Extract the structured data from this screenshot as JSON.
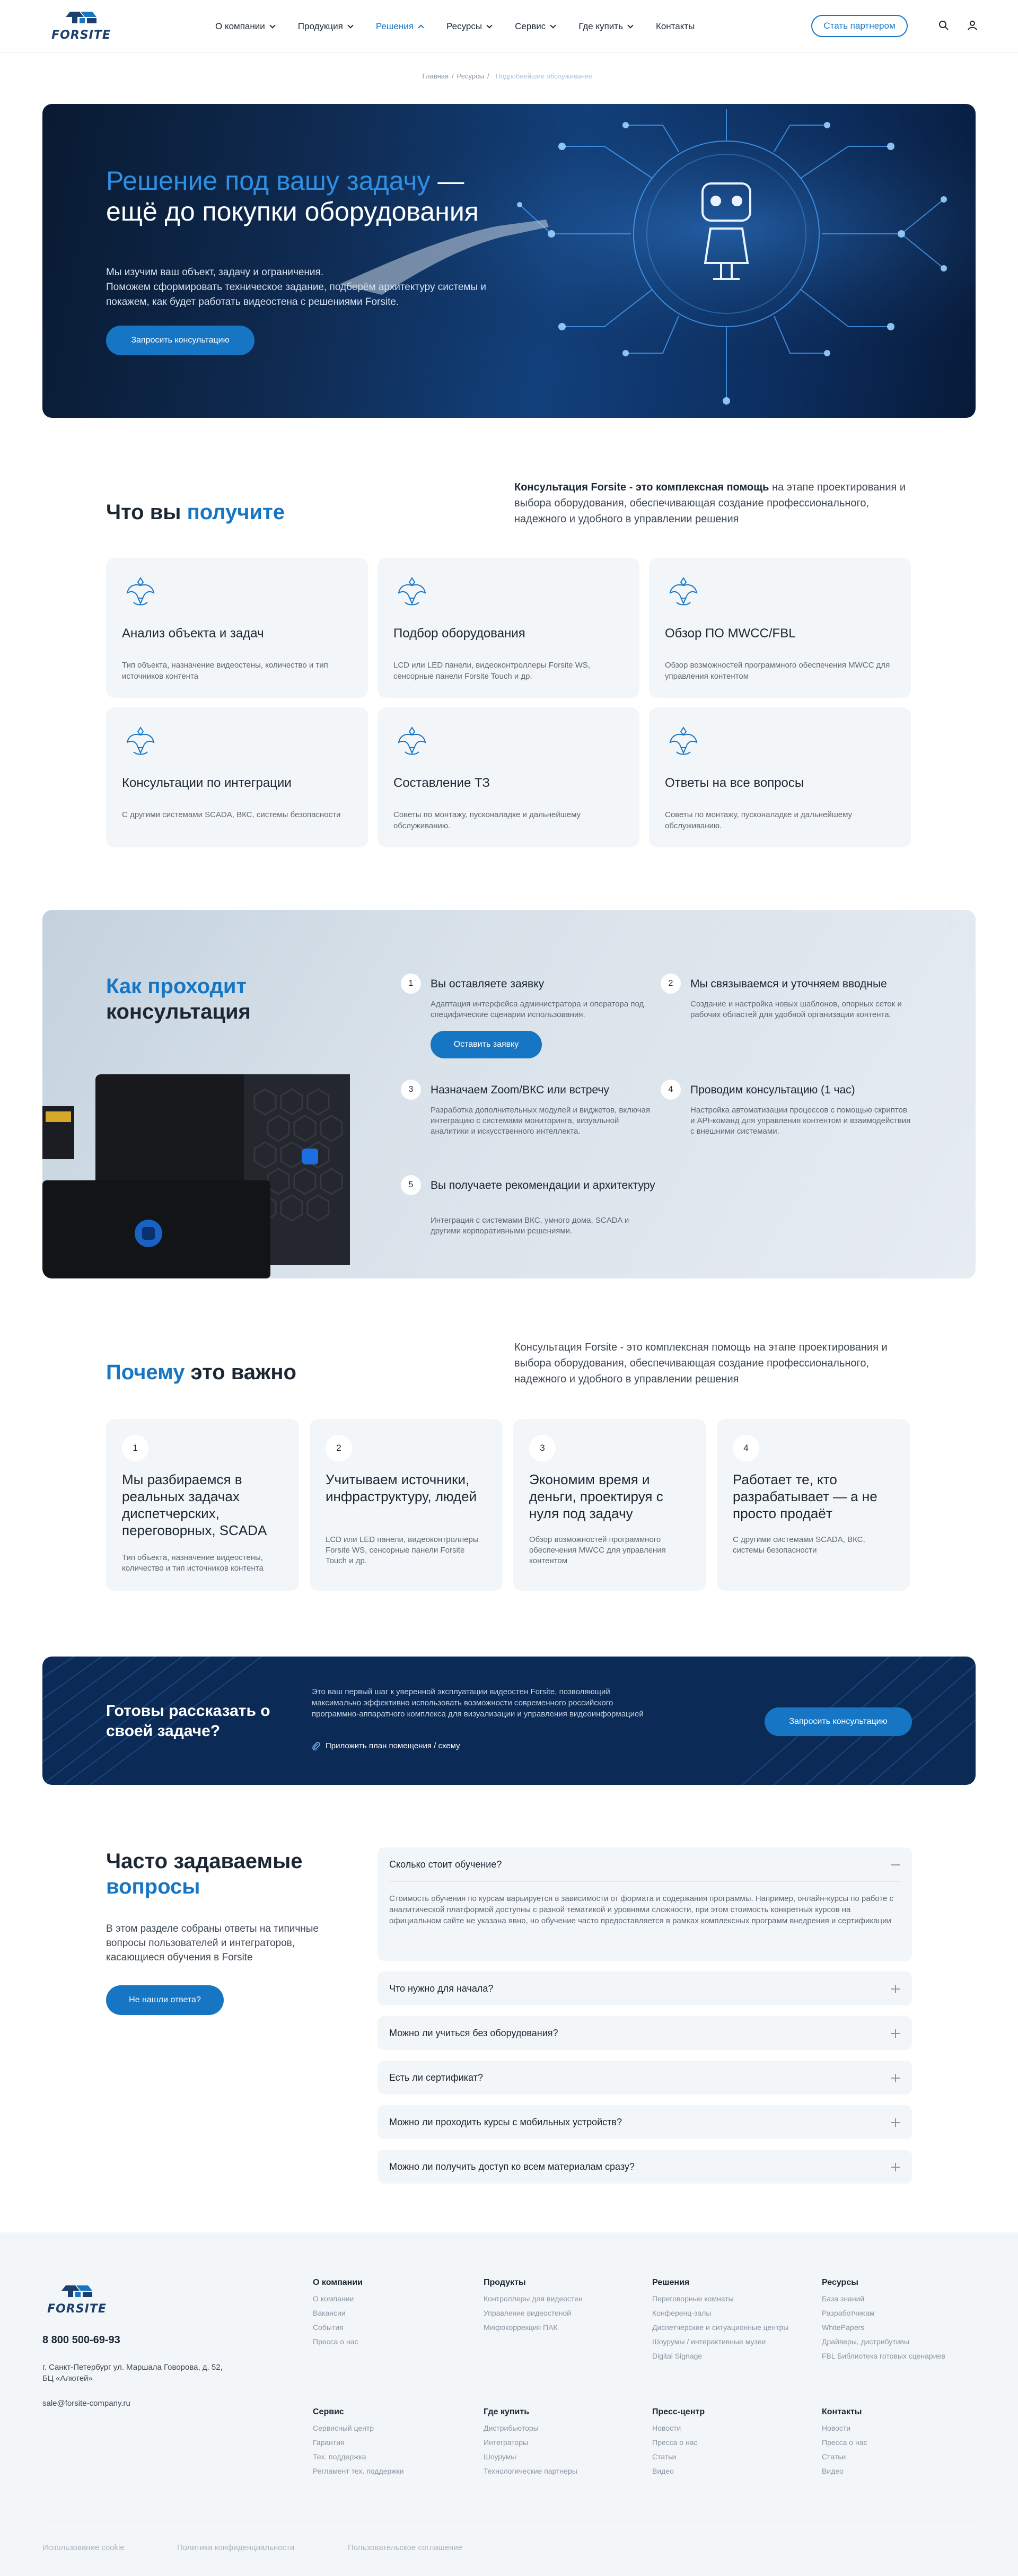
{
  "brand": {
    "logo_text": "FORSITE",
    "primary": "#1676c4",
    "dark": "#0b2a55"
  },
  "header": {
    "nav": [
      {
        "label": "О компании"
      },
      {
        "label": "Продукция"
      },
      {
        "label": "Решения",
        "active": true
      },
      {
        "label": "Ресурсы"
      },
      {
        "label": "Сервис"
      },
      {
        "label": "Где купить"
      },
      {
        "label": "Контакты"
      }
    ],
    "partner_button": "Стать партнером",
    "icons": [
      "search-icon",
      "user-icon"
    ]
  },
  "breadcrumb": {
    "items": [
      "Главная",
      "Ресурсы",
      "Подробнейшие обслуживание"
    ]
  },
  "hero": {
    "title_highlight": "Решение под вашу задачу",
    "title_rest": " — ещё до покупки оборудования",
    "text_1": "Мы изучим ваш объект, задачу и ограничения.",
    "text_2": "Поможем сформировать техническое задание, подберём архитектуру системы и покажем, как будет работать видеостена с решениями Forsite.",
    "button": "Запросить консультацию"
  },
  "benefits": {
    "title_plain": "Что вы ",
    "title_highlight": "получите",
    "lead_bold": "Консультация Forsite - это комплексная помощь",
    "lead_rest": " на этапе проектирования и выбора оборудования, обеспечивающая создание профессионального, надежного и удобного в управлении решения",
    "cards": [
      {
        "title": "Анализ объекта и задач",
        "desc": "Тип объекта, назначение видеостены, количество и тип источников контента"
      },
      {
        "title": "Подбор оборудования",
        "desc": "LCD или LED панели, видеоконтроллеры Forsite WS, сенсорные панели Forsite Touch и др."
      },
      {
        "title": "Обзор ПО MWCC/FBL",
        "desc": "Обзор возможностей программного обеспечения MWCC для управления контентом"
      },
      {
        "title": "Консультации по интеграции",
        "desc": "С другими системами SCADA, ВКС, системы безопасности"
      },
      {
        "title": "Составление ТЗ",
        "desc": "Советы по монтажу, пусконаладке и дальнейшему обслуживанию."
      },
      {
        "title": "Ответы на все вопросы",
        "desc": "Советы по монтажу, пусконаладке и дальнейшему обслуживанию."
      }
    ]
  },
  "consultation": {
    "title_highlight": "Как проходит",
    "title_rest": "консультация",
    "button": "Оставить заявку",
    "steps": [
      {
        "num": "1",
        "title": "Вы оставляете заявку",
        "desc": "Адаптация интерфейса администратора и оператора под специфические сценарии использования."
      },
      {
        "num": "2",
        "title": "Мы связываемся и уточняем вводные",
        "desc": "Создание и настройка новых шаблонов, опорных сеток и рабочих областей для удобной организации контента."
      },
      {
        "num": "3",
        "title": "Назначаем Zoom/ВКС или встречу",
        "desc": "Разработка дополнительных модулей и виджетов, включая интеграцию с системами мониторинга, визуальной аналитики и искусственного интеллекта."
      },
      {
        "num": "4",
        "title": "Проводим консультацию (1 час)",
        "desc": "Настройка автоматизации процессов с помощью скриптов и API-команд для управления контентом и взаимодействия с внешними системами."
      },
      {
        "num": "5",
        "title": "Вы получаете рекомендации и архитектуру",
        "desc": "Интеграция с системами ВКС, умного дома, SCADA и другими корпоративными решениями."
      }
    ]
  },
  "why": {
    "title_highlight": "Почему",
    "title_rest": " это важно",
    "lead": "Консультация Forsite - это комплексная помощь на этапе проектирования и выбора оборудования, обеспечивающая создание профессионального, надежного и удобного в управлении решения",
    "cards": [
      {
        "num": "1",
        "title": "Мы разбираемся в реальных задачах диспетчерских, переговорных, SCADA",
        "desc": "Тип объекта, назначение видеостены, количество и тип источников контента"
      },
      {
        "num": "2",
        "title": "Учитываем источники, инфраструктуру, людей",
        "desc": "LCD или LED панели, видеоконтроллеры Forsite WS, сенсорные панели Forsite Touch и др."
      },
      {
        "num": "3",
        "title": "Экономим время и деньги, проектируя с нуля под задачу",
        "desc": "Обзор возможностей программного обеспечения MWCC для управления контентом"
      },
      {
        "num": "4",
        "title": "Работает те, кто разрабатывает — а не просто продаёт",
        "desc": "С другими системами SCADA, ВКС, системы безопасности"
      }
    ]
  },
  "cta": {
    "title": "Готовы рассказать о своей задаче?",
    "text": "Это ваш первый шаг к уверенной эксплуатации видеостен Forsite, позволяющий максимально эффективно использовать возможности современного российского программно-аппаратного комплекса для визуализации и управления видеоинформацией",
    "attach": "Приложить план помещения / схему",
    "button": "Запросить консультацию"
  },
  "faq": {
    "title_plain": "Часто задаваемые",
    "title_highlight": "вопросы",
    "lead": "В этом разделе собраны ответы на типичные вопросы пользователей и интеграторов, касающиеся обучения в Forsite",
    "button": "Не нашли ответа?",
    "items": [
      {
        "q": "Сколько стоит обучение?",
        "a": "Стоимость обучения по курсам варьируется в зависимости от формата и содержания программы. Например, онлайн-курсы по работе с аналитической платформой доступны с разной тематикой и уровнями сложности, при этом стоимость конкретных курсов на официальном сайте не указана явно, но обучение часто предоставляется в рамках комплексных программ внедрения и сертификации",
        "open": true
      },
      {
        "q": "Что нужно для начала?"
      },
      {
        "q": "Можно ли учиться без оборудования?"
      },
      {
        "q": "Есть ли сертификат?"
      },
      {
        "q": "Можно ли проходить курсы с мобильных устройств?"
      },
      {
        "q": "Можно ли получить доступ ко всем материалам сразу?"
      }
    ]
  },
  "footer": {
    "phone": "8 800 500-69-93",
    "address": "г. Санкт-Петербург ул. Маршала Говорова, д. 52, БЦ «Алютей»",
    "email": "sale@forsite-company.ru",
    "columns": [
      {
        "title": "О компании",
        "links": [
          "О компании",
          "Вакансии",
          "События",
          "Пресса о нас"
        ]
      },
      {
        "title": "Продукты",
        "links": [
          "Контроллеры для видеостен",
          "Управление видеостеной",
          "Микрокоррекция ПАК"
        ]
      },
      {
        "title": "Решения",
        "links": [
          "Переговорные комнаты",
          "Конференц-залы",
          "Диспетчерские и ситуационные центры",
          "Шоурумы / интерактивные музеи",
          "Digital Signage"
        ]
      },
      {
        "title": "Ресурсы",
        "links": [
          "База знаний",
          "Разработчикам",
          "WhitePapers",
          "Драйверы, дистрибутивы",
          "FBL Библиотека готовых сценариев"
        ]
      },
      {
        "title": "Сервис",
        "links": [
          "Сервисный центр",
          "Гарантия",
          "Тех. поддержка",
          "Регламент тех. поддержки"
        ]
      },
      {
        "title": "Где купить",
        "links": [
          "Дистрибьюторы",
          "Интеграторы",
          "Шоурумы",
          "Технологические партнеры"
        ]
      },
      {
        "title": "Пресс-центр",
        "links": [
          "Новости",
          "Пресса о нас",
          "Статьи",
          "Видео"
        ]
      },
      {
        "title": "Контакты",
        "links": [
          "Новости",
          "Пресса о нас",
          "Статьи",
          "Видео"
        ]
      }
    ],
    "bottom_links": [
      "Использование cookie",
      "Политика конфиденциальности",
      "Пользовательское соглашение"
    ]
  }
}
